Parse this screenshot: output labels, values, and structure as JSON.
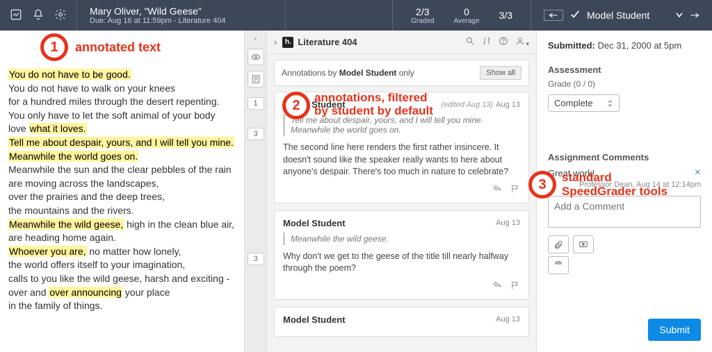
{
  "topbar": {
    "title": "Mary Oliver, \"Wild Geese\"",
    "subtitle": "Due: Aug 16 at 11:59pm - Literature 404",
    "stats": {
      "graded_value": "2/3",
      "graded_label": "Graded",
      "avg_value": "0",
      "avg_label": "Average",
      "count_value": "3/3"
    },
    "student_name": "Model Student"
  },
  "document_lines": [
    {
      "pre": "",
      "hl": "You do not have to be good.",
      "post": ""
    },
    {
      "pre": "You do not have to walk on your knees",
      "hl": "",
      "post": ""
    },
    {
      "pre": "for a hundred miles through the desert repenting.",
      "hl": "",
      "post": ""
    },
    {
      "pre": "You only have to let the soft animal of your body",
      "hl": "",
      "post": ""
    },
    {
      "pre": "love ",
      "hl": "what it loves.",
      "post": ""
    },
    {
      "pre": "",
      "hl": "Tell me about despair, yours, and I will tell you mine.",
      "post": ""
    },
    {
      "pre": "",
      "hl": "Meanwhile the world goes on.",
      "post": ""
    },
    {
      "pre": "Meanwhile the sun and the clear pebbles of the rain",
      "hl": "",
      "post": ""
    },
    {
      "pre": "are moving across the landscapes,",
      "hl": "",
      "post": ""
    },
    {
      "pre": "over the prairies and the deep trees,",
      "hl": "",
      "post": ""
    },
    {
      "pre": "the mountains and the rivers.",
      "hl": "",
      "post": ""
    },
    {
      "pre": "",
      "hl": "Meanwhile the wild geese,",
      "post": " high in the clean blue air,"
    },
    {
      "pre": "are heading home again.",
      "hl": "",
      "post": ""
    },
    {
      "pre": "",
      "hl": "Whoever you are,",
      "post": " no matter how lonely,"
    },
    {
      "pre": "the world offers itself to your imagination,",
      "hl": "",
      "post": ""
    },
    {
      "pre": "calls to you like the wild geese, harsh and exciting -",
      "hl": "",
      "post": ""
    },
    {
      "pre": "over and ",
      "hl": "over announcing",
      "post": " your place"
    },
    {
      "pre": "in the family of things.",
      "hl": "",
      "post": ""
    }
  ],
  "mid": {
    "course": "Literature 404",
    "filter_prefix": "Annotations by ",
    "filter_name": "Model Student",
    "filter_suffix": " only",
    "show_all": "Show all",
    "gutter_counts": [
      "1",
      "3",
      "3"
    ],
    "cards": [
      {
        "author": "Model Student",
        "date_edited": "(edited Aug 13)",
        "date": "Aug 13",
        "quote": "Tell me about despair, yours, and I will tell you mine. Meanwhile the world goes on.",
        "body": "The second line here renders the first rather insincere. It doesn't sound like the speaker really wants to here about anyone's despair. There's too much in nature to celebrate?"
      },
      {
        "author": "Model Student",
        "date_edited": "",
        "date": "Aug 13",
        "quote": "Meanwhile the wild geese,",
        "body": "Why don't we get to the geese of the title till nearly halfway through the poem?"
      },
      {
        "author": "Model Student",
        "date_edited": "",
        "date": "Aug 13",
        "quote": "",
        "body": ""
      }
    ]
  },
  "sg": {
    "submitted_label": "Submitted:",
    "submitted_value": "Dec 31, 2000 at 5pm",
    "assessment_h": "Assessment",
    "grade_line": "Grade (0 / 0)",
    "grade_value": "Complete",
    "comments_h": "Assignment Comments",
    "comment_text": "Great work!",
    "comment_meta": "Professor Dean, Aug 14 at 12:14pm",
    "add_placeholder": "Add a Comment",
    "submit": "Submit"
  },
  "callouts": {
    "c1": "annotated text",
    "c2a": "annotations, filtered",
    "c2b": "by student by default",
    "c3a": "standard",
    "c3b": "SpeedGrader tools"
  }
}
